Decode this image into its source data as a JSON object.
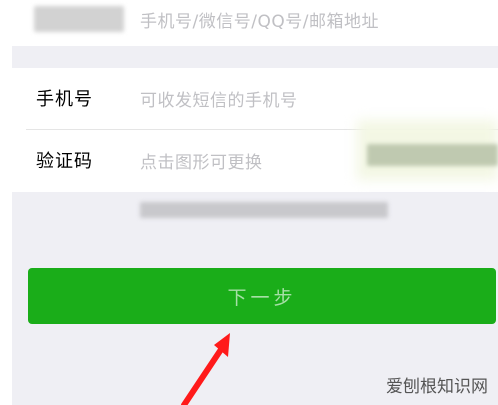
{
  "account": {
    "placeholder": "手机号/微信号/QQ号/邮箱地址"
  },
  "form": {
    "phone_label": "手机号",
    "phone_placeholder": "可收发短信的手机号",
    "code_label": "验证码",
    "code_placeholder": "点击图形可更换"
  },
  "next_button_label": "下一步",
  "watermark": "爱刨根知识网",
  "colors": {
    "background": "#efeff4",
    "button": "#1aad19",
    "button_text": "#a6e0a6",
    "arrow": "#ff1a1a"
  },
  "icons": {
    "arrow": "red-arrow-pointing-up"
  }
}
